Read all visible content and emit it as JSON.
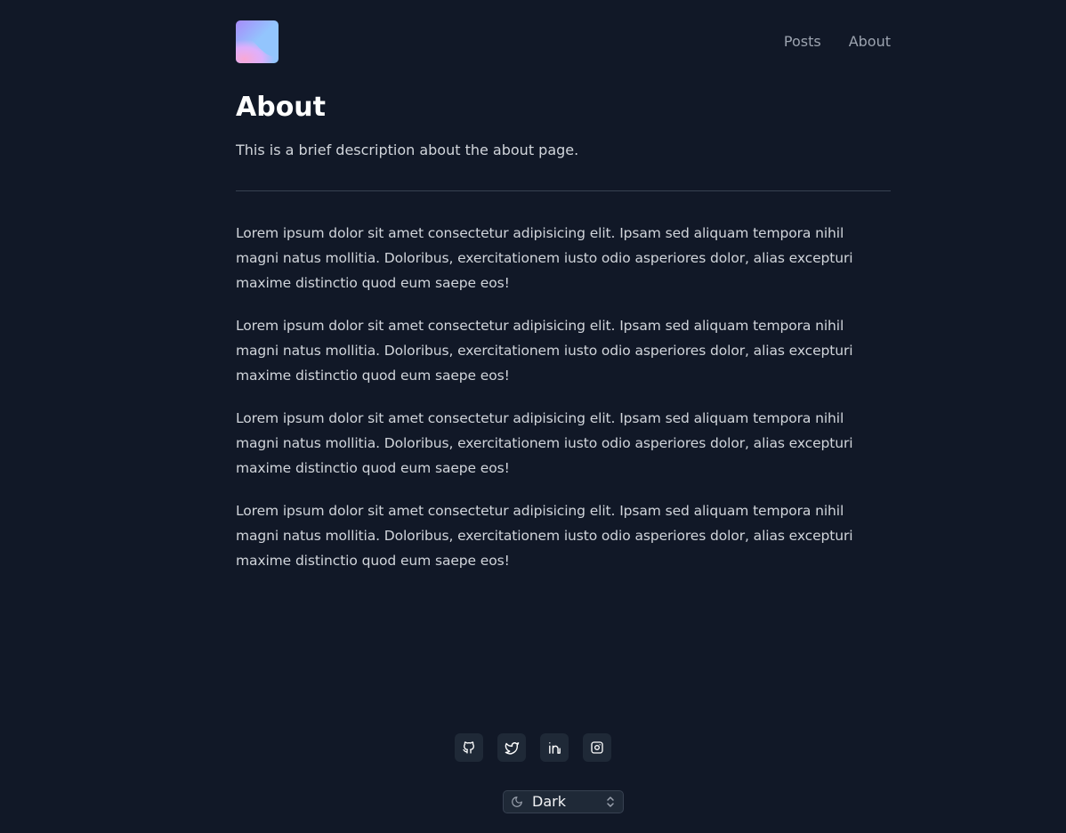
{
  "header": {
    "logo_icon": "gradient-logo",
    "nav": [
      {
        "label": "Posts"
      },
      {
        "label": "About"
      }
    ]
  },
  "page": {
    "title": "About",
    "description": "This is a brief description about the about page."
  },
  "content": {
    "paragraphs": [
      "Lorem ipsum dolor sit amet consectetur adipisicing elit. Ipsam sed aliquam tempora nihil magni natus mollitia. Doloribus, exercitationem iusto odio asperiores dolor, alias excepturi maxime distinctio quod eum saepe eos!",
      "Lorem ipsum dolor sit amet consectetur adipisicing elit. Ipsam sed aliquam tempora nihil magni natus mollitia. Doloribus, exercitationem iusto odio asperiores dolor, alias excepturi maxime distinctio quod eum saepe eos!",
      "Lorem ipsum dolor sit amet consectetur adipisicing elit. Ipsam sed aliquam tempora nihil magni natus mollitia. Doloribus, exercitationem iusto odio asperiores dolor, alias excepturi maxime distinctio quod eum saepe eos!",
      "Lorem ipsum dolor sit amet consectetur adipisicing elit. Ipsam sed aliquam tempora nihil magni natus mollitia. Doloribus, exercitationem iusto odio asperiores dolor, alias excepturi maxime distinctio quod eum saepe eos!"
    ]
  },
  "footer": {
    "social": [
      {
        "icon": "github-icon"
      },
      {
        "icon": "twitter-icon"
      },
      {
        "icon": "linkedin-icon"
      },
      {
        "icon": "instagram-icon"
      }
    ],
    "theme": {
      "icon": "moon-icon",
      "selected": "Dark"
    }
  },
  "colors": {
    "background": "#111827",
    "text": "#d1d5db",
    "nav_text": "#9ca3af",
    "heading": "#ffffff",
    "divider": "#374151",
    "button_bg": "#1f2937"
  }
}
